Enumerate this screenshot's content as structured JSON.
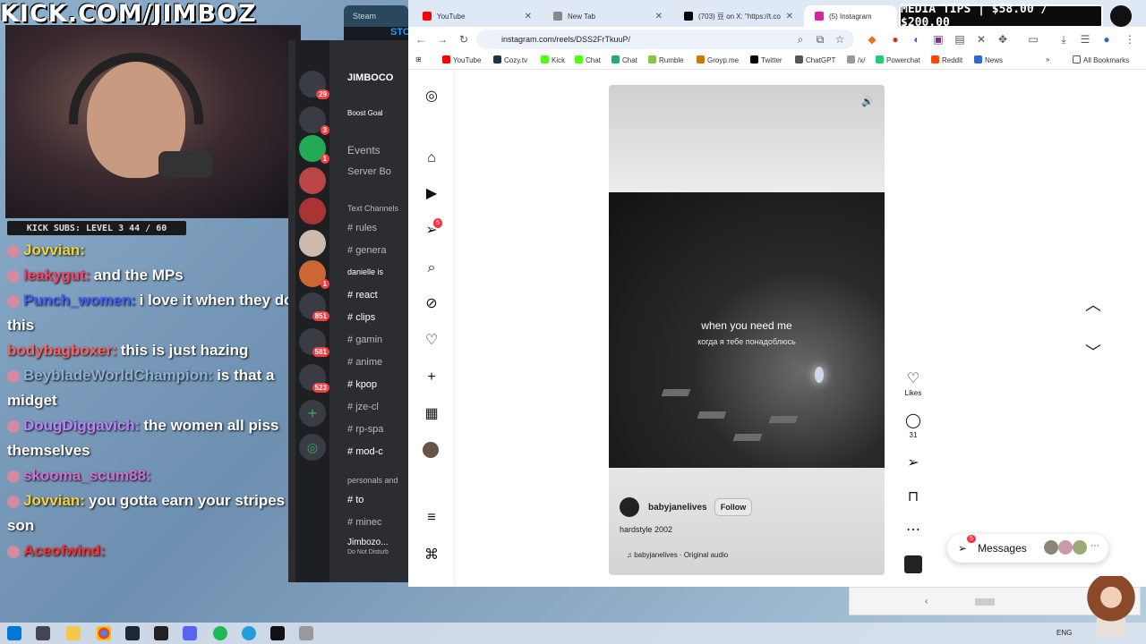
{
  "overlay": {
    "banner": "KICK.COM/JIMBOZ",
    "subs": "KICK SUBS: LEVEL 3 44 / 60",
    "media_tips": "MEDIA TIPS | $58.00 / $200.00"
  },
  "chat": [
    {
      "user": "Jovvian:",
      "msg": "",
      "color": "#f0d040"
    },
    {
      "user": "leakygut:",
      "msg": "and the MPs",
      "color": "#ff4060"
    },
    {
      "user": "Punch_women:",
      "msg": "i love it when they do this",
      "color": "#4060ff"
    },
    {
      "user": "bodybagboxer:",
      "msg": "this is just hazing",
      "color": "#ff6060"
    },
    {
      "user": "BeybladeWorldChampion:",
      "msg": "is that a midget",
      "color": "#8fb0d0"
    },
    {
      "user": "DougDiggavich:",
      "msg": "the women all piss themselves",
      "color": "#c080ff"
    },
    {
      "user": "skooma_scum88:",
      "msg": "",
      "color": "#d070d0"
    },
    {
      "user": "Jovvian:",
      "msg": "you gotta earn your stripes son",
      "color": "#f0d040"
    },
    {
      "user": "Aceofwind:",
      "msg": "",
      "color": "#ff3030"
    }
  ],
  "discord": {
    "server": "JIMBOCO",
    "boost": "Boost Goal",
    "events": "Events",
    "server_boosts": "Server Bo",
    "section_text": "Text Channels",
    "channels": [
      "rules",
      "genera",
      "danielle is",
      "react",
      "clips",
      "gamin",
      "anime",
      "kpop",
      "jze-cl",
      "rp-spa",
      "mod-c"
    ],
    "section_personals": "personals and",
    "channels2": [
      "to",
      "minec"
    ],
    "user": "Jimbozo...",
    "status": "Do Not Disturb",
    "badges": [
      "29",
      "3",
      "1",
      "1",
      "851",
      "581",
      "523"
    ]
  },
  "steam": {
    "tab": "Steam",
    "nav": "STO"
  },
  "browser": {
    "tabs": [
      {
        "label": "YouTube",
        "color": "#ff0000"
      },
      {
        "label": "New Tab",
        "color": "#888888"
      },
      {
        "label": "(703) 豆 on X: \"https://t.co",
        "color": "#000000"
      },
      {
        "label": "(5) Instagram",
        "color": "#d6249f"
      }
    ],
    "url": "instagram.com/reels/DSS2FrTkuuP/",
    "bookmarks": [
      "YouTube",
      "Cozy.tv",
      "Kick",
      "Chat",
      "Chat",
      "Rumble",
      "Groyp.me",
      "Twitter",
      "ChatGPT",
      "/x/",
      "Powerchat",
      "Reddit",
      "News"
    ],
    "all_bookmarks": "All Bookmarks"
  },
  "instagram": {
    "notif_badge": "5",
    "reel": {
      "caption_en": "when you need me",
      "caption_ru": "когда я тебе понадоблюсь",
      "username": "babyjanelives",
      "follow": "Follow",
      "description": "hardstyle 2002",
      "audio": "babyjanelives · Original audio"
    },
    "actions": {
      "likes": "Likes",
      "comments": "31"
    },
    "messages": {
      "label": "Messages",
      "badge": "5"
    }
  },
  "taskbar": {
    "lang": "ENG"
  }
}
